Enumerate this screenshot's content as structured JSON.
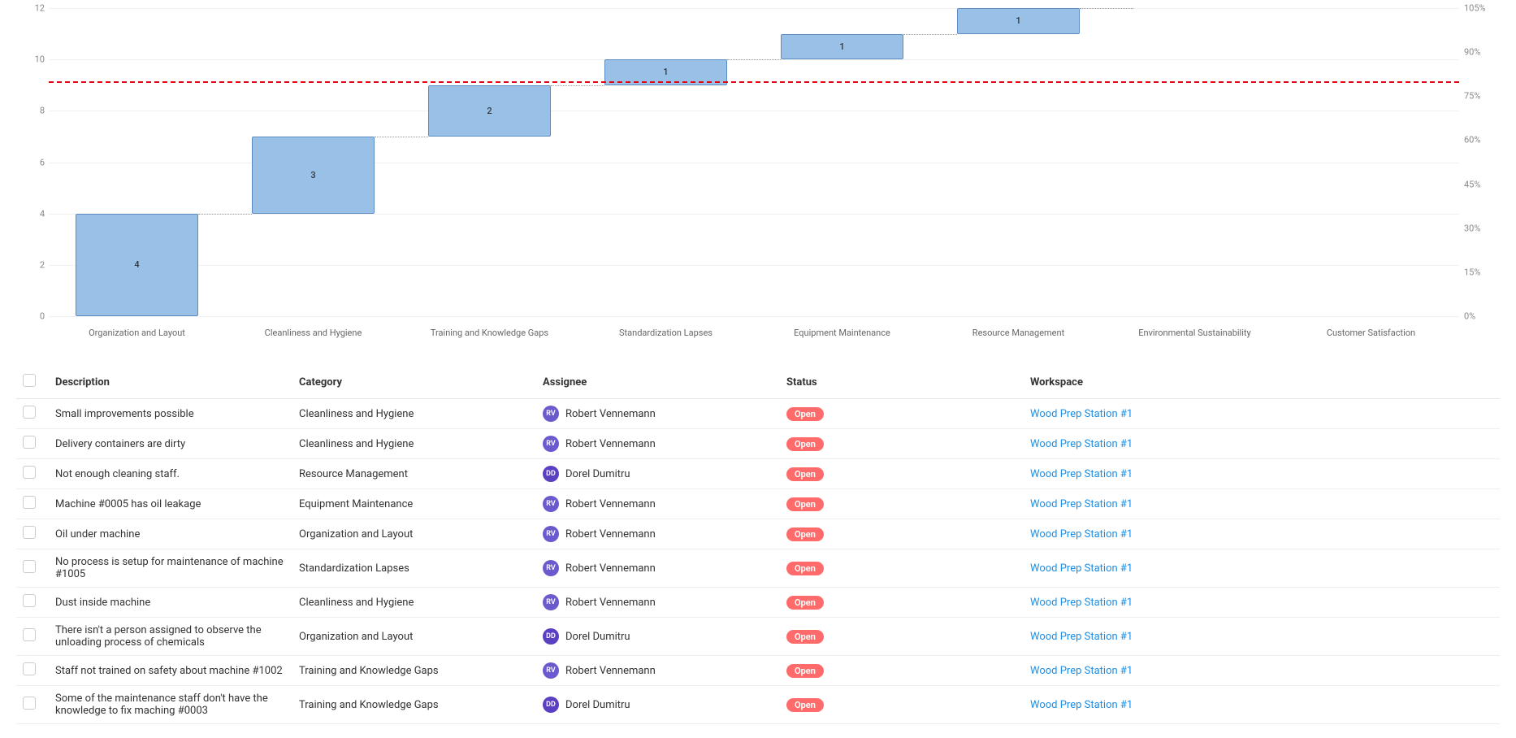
{
  "chart_data": {
    "type": "waterfall",
    "categories": [
      "Organization and Layout",
      "Cleanliness and Hygiene",
      "Training and Knowledge Gaps",
      "Standardization Lapses",
      "Equipment Maintenance",
      "Resource Management",
      "Environmental Sustainability",
      "Customer Satisfaction"
    ],
    "values": [
      4,
      3,
      2,
      1,
      1,
      1,
      0,
      0
    ],
    "cumulative": [
      4,
      7,
      9,
      10,
      11,
      12,
      12,
      12
    ],
    "y_left_ticks": [
      0,
      2,
      4,
      6,
      8,
      10,
      12
    ],
    "y_left_max": 12,
    "y_right_ticks": [
      "0%",
      "15%",
      "30%",
      "45%",
      "60%",
      "75%",
      "90%",
      "105%"
    ],
    "y_right_max_pct": 105,
    "reference_line_pct": 80
  },
  "table": {
    "headers": {
      "description": "Description",
      "category": "Category",
      "assignee": "Assignee",
      "status": "Status",
      "workspace": "Workspace"
    },
    "rows": [
      {
        "description": "Small improvements possible",
        "category": "Cleanliness and Hygiene",
        "assignee": "Robert Vennemann",
        "initials": "RV",
        "avatar_color": "#6a5acd",
        "status": "Open",
        "workspace": "Wood Prep Station #1"
      },
      {
        "description": "Delivery containers are dirty",
        "category": "Cleanliness and Hygiene",
        "assignee": "Robert Vennemann",
        "initials": "RV",
        "avatar_color": "#6a5acd",
        "status": "Open",
        "workspace": "Wood Prep Station #1"
      },
      {
        "description": "Not enough cleaning staff.",
        "category": "Resource Management",
        "assignee": "Dorel Dumitru",
        "initials": "DD",
        "avatar_color": "#5b3fc2",
        "status": "Open",
        "workspace": "Wood Prep Station #1"
      },
      {
        "description": "Machine #0005 has oil leakage",
        "category": "Equipment Maintenance",
        "assignee": "Robert Vennemann",
        "initials": "RV",
        "avatar_color": "#6a5acd",
        "status": "Open",
        "workspace": "Wood Prep Station #1"
      },
      {
        "description": "Oil under machine",
        "category": "Organization and Layout",
        "assignee": "Robert Vennemann",
        "initials": "RV",
        "avatar_color": "#6a5acd",
        "status": "Open",
        "workspace": "Wood Prep Station #1"
      },
      {
        "description": "No process is setup for maintenance of machine #1005",
        "category": "Standardization Lapses",
        "assignee": "Robert Vennemann",
        "initials": "RV",
        "avatar_color": "#6a5acd",
        "status": "Open",
        "workspace": "Wood Prep Station #1"
      },
      {
        "description": "Dust inside machine",
        "category": "Cleanliness and Hygiene",
        "assignee": "Robert Vennemann",
        "initials": "RV",
        "avatar_color": "#6a5acd",
        "status": "Open",
        "workspace": "Wood Prep Station #1"
      },
      {
        "description": "There isn't a person assigned to observe the unloading process of chemicals",
        "category": "Organization and Layout",
        "assignee": "Dorel Dumitru",
        "initials": "DD",
        "avatar_color": "#5b3fc2",
        "status": "Open",
        "workspace": "Wood Prep Station #1"
      },
      {
        "description": "Staff not trained on safety about machine #1002",
        "category": "Training and Knowledge Gaps",
        "assignee": "Robert Vennemann",
        "initials": "RV",
        "avatar_color": "#6a5acd",
        "status": "Open",
        "workspace": "Wood Prep Station #1"
      },
      {
        "description": "Some of the maintenance staff don't have the knowledge to fix maching #0003",
        "category": "Training and Knowledge Gaps",
        "assignee": "Dorel Dumitru",
        "initials": "DD",
        "avatar_color": "#5b3fc2",
        "status": "Open",
        "workspace": "Wood Prep Station #1"
      }
    ]
  }
}
